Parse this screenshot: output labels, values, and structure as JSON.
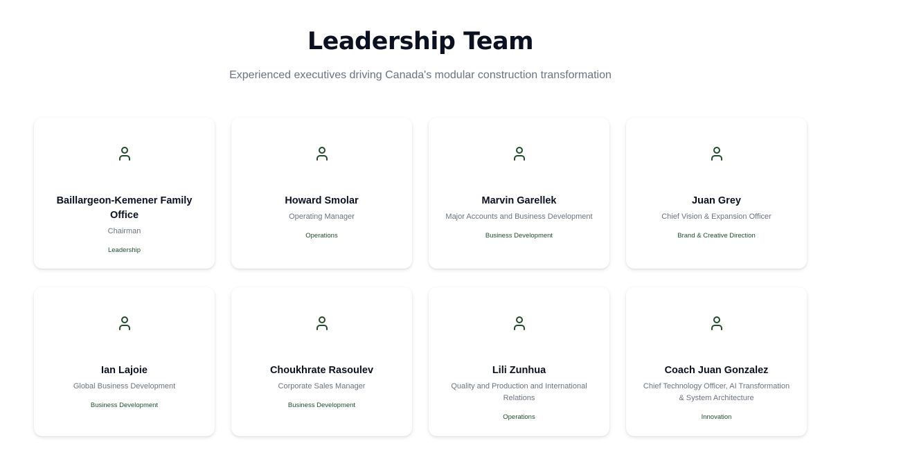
{
  "header": {
    "title": "Leadership Team",
    "subtitle": "Experienced executives driving Canada's modular construction transformation"
  },
  "icon": "user-icon",
  "accent_color": "#1f4d2b",
  "members": [
    {
      "name": "Baillargeon-Kemener Family Office",
      "role": "Chairman",
      "department": "Leadership"
    },
    {
      "name": "Howard Smolar",
      "role": "Operating Manager",
      "department": "Operations"
    },
    {
      "name": "Marvin Garellek",
      "role": "Major Accounts and Business Development",
      "department": "Business Development"
    },
    {
      "name": "Juan Grey",
      "role": "Chief Vision & Expansion Officer",
      "department": "Brand & Creative Direction"
    },
    {
      "name": "Ian Lajoie",
      "role": "Global Business Development",
      "department": "Business Development"
    },
    {
      "name": "Choukhrate Rasoulev",
      "role": "Corporate Sales Manager",
      "department": "Business Development"
    },
    {
      "name": "Lili Zunhua",
      "role": "Quality and Production and International Relations",
      "department": "Operations"
    },
    {
      "name": "Coach Juan Gonzalez",
      "role": "Chief Technology Officer, AI Transformation & System Architecture",
      "department": "Innovation"
    }
  ]
}
